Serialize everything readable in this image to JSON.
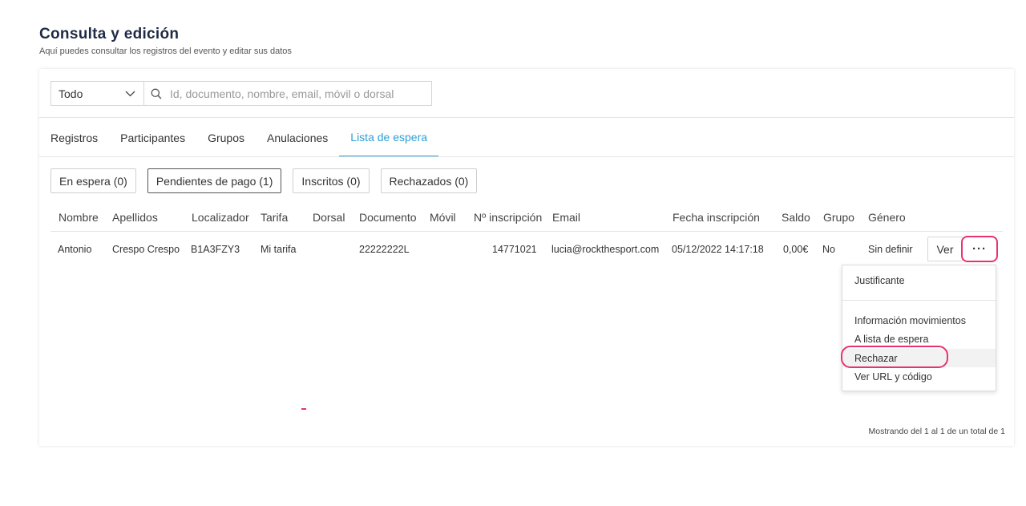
{
  "header": {
    "title": "Consulta y edición",
    "subtitle": "Aquí puedes consultar los registros del evento y editar sus datos"
  },
  "filter": {
    "select_value": "Todo",
    "search_placeholder": "Id, documento, nombre, email, móvil o dorsal"
  },
  "tabs": [
    {
      "label": "Registros"
    },
    {
      "label": "Participantes"
    },
    {
      "label": "Grupos"
    },
    {
      "label": "Anulaciones"
    },
    {
      "label": "Lista de espera",
      "active": true
    }
  ],
  "status_filters": [
    {
      "label": "En espera (0)"
    },
    {
      "label": "Pendientes de pago (1)",
      "active": true
    },
    {
      "label": "Inscritos (0)"
    },
    {
      "label": "Rechazados (0)"
    }
  ],
  "table": {
    "columns": [
      "Nombre",
      "Apellidos",
      "Localizador",
      "Tarifa",
      "Dorsal",
      "Documento",
      "Móvil",
      "Nº inscripción",
      "Email",
      "Fecha inscripción",
      "Saldo",
      "Grupo",
      "Género"
    ],
    "rows": [
      {
        "nombre": "Antonio",
        "apellidos": "Crespo Crespo",
        "localizador": "B1A3FZY3",
        "tarifa": "Mi tarifa",
        "dorsal": "",
        "documento": "22222222L",
        "movil": "",
        "inscripcion": "14771021",
        "email": "lucia@rockthesport.com",
        "fecha": "05/12/2022 14:17:18",
        "saldo": "0,00€",
        "grupo": "No",
        "genero": "Sin definir"
      }
    ],
    "view_button": "Ver",
    "more_button": "···"
  },
  "menu": {
    "items": [
      "Justificante",
      "Información movimientos",
      "A lista de espera",
      "Rechazar",
      "Ver URL y código"
    ]
  },
  "footer": {
    "pagination_text": "Mostrando del 1 al 1 de un total de 1"
  },
  "colors": {
    "accent": "#2e9fd8",
    "highlight": "#e8336f"
  }
}
